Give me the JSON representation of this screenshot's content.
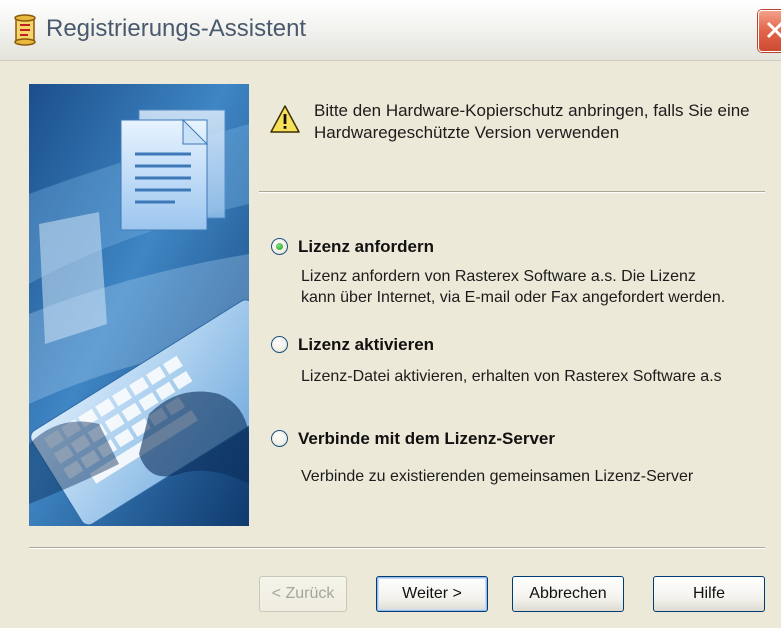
{
  "window": {
    "title": "Registrierungs-Assistent"
  },
  "notice": {
    "icon": "warning-icon",
    "text_line1": "Bitte den Hardware-Kopierschutz anbringen, falls Sie eine",
    "text_line2": "Hardwaregeschützte Version verwenden"
  },
  "options": [
    {
      "label": "Lizenz anfordern",
      "selected": true,
      "description_line1": "Lizenz anfordern von Rasterex Software a.s. Die Lizenz",
      "description_line2": "kann über Internet, via E-mail oder Fax angefordert werden."
    },
    {
      "label": "Lizenz aktivieren",
      "selected": false,
      "description_line1": "Lizenz-Datei aktivieren, erhalten von Rasterex Software a.s"
    },
    {
      "label": "Verbinde mit dem Lizenz-Server",
      "selected": false,
      "description_line1": "Verbinde zu existierenden gemeinsamen Lizenz-Server"
    }
  ],
  "buttons": {
    "back": "< Zurück",
    "next": "Weiter >",
    "cancel": "Abbrechen",
    "help": "Hilfe"
  },
  "colors": {
    "dialog_bg": "#ece9d8",
    "title_text": "#4a5a6e",
    "close_red": "#e1654a",
    "radio_green": "#21a121"
  }
}
